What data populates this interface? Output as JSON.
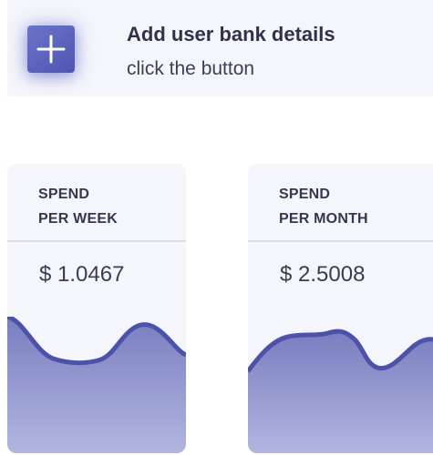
{
  "banner": {
    "title": "Add user bank details",
    "subtitle": "click the button",
    "add_button_icon": "plus-icon"
  },
  "cards": [
    {
      "label_line1": "SPEND",
      "label_line2": "PER WEEK",
      "amount": "$ 1.0467"
    },
    {
      "label_line1": "SPEND",
      "label_line2": "PER MONTH",
      "amount": "$ 2.5008"
    }
  ],
  "colors": {
    "accent": "#5a60b8",
    "wave_top": "#7d80c2",
    "wave_bottom": "#aeb3dd",
    "wave_stroke": "#4c52a8",
    "text_dark": "#2f3349",
    "card_bg": "#f5f6fb"
  }
}
